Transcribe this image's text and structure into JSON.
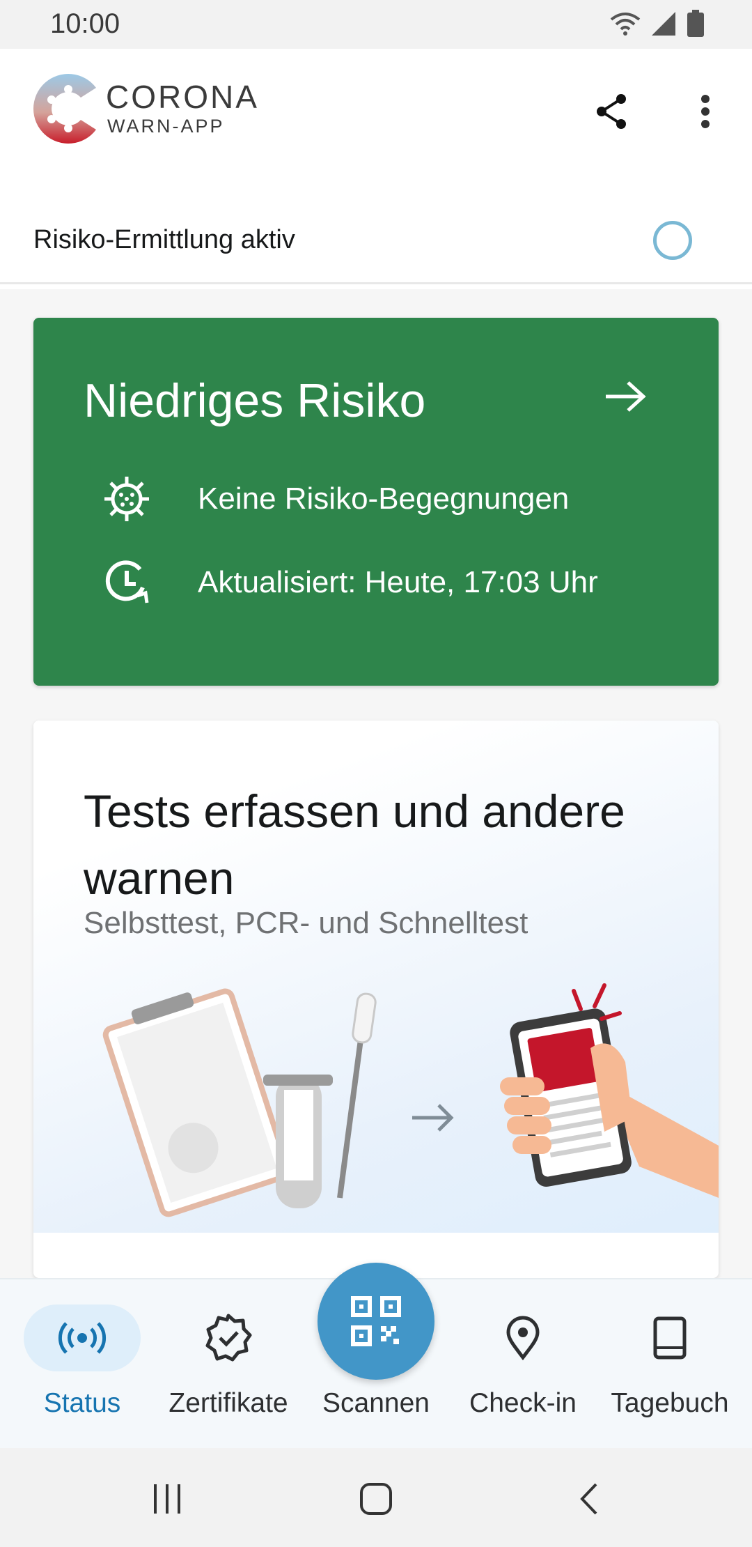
{
  "status_bar": {
    "time": "10:00",
    "icons": [
      "wifi-icon",
      "signal-icon",
      "battery-icon"
    ]
  },
  "app": {
    "logo_line1": "CORONA",
    "logo_line2": "WARN-APP",
    "share_icon": "share-icon",
    "more_icon": "more-vert-icon"
  },
  "tracing": {
    "label": "Risiko-Ermittlung aktiv",
    "indicator_icon": "progress-ring-icon"
  },
  "risk_card": {
    "title": "Niedriges Risiko",
    "arrow_icon": "arrow-right-icon",
    "rows": [
      {
        "icon": "virus-icon",
        "text": "Keine Risiko-Begegnungen"
      },
      {
        "icon": "clock-refresh-icon",
        "text": "Aktualisiert: Heute, 17:03 Uhr"
      }
    ],
    "color": "#2e854b"
  },
  "tests_card": {
    "title": "Tests erfassen und andere warnen",
    "subtitle": "Selbsttest, PCR- und Schnelltest",
    "illustration_icon": "test-registration-illustration"
  },
  "bottom_nav": {
    "items": [
      {
        "label": "Status",
        "icon": "broadcast-icon",
        "active": true
      },
      {
        "label": "Zertifikate",
        "icon": "certificate-badge-icon",
        "active": false
      },
      {
        "label": "Scannen",
        "icon": "qr-code-icon",
        "active": false
      },
      {
        "label": "Check-in",
        "icon": "location-pin-icon",
        "active": false
      },
      {
        "label": "Tagebuch",
        "icon": "book-icon",
        "active": false
      }
    ],
    "accent": "#1674b0",
    "fab_color": "#4296c8"
  },
  "system_nav": {
    "icons": [
      "recents-icon",
      "home-icon",
      "back-icon"
    ]
  }
}
